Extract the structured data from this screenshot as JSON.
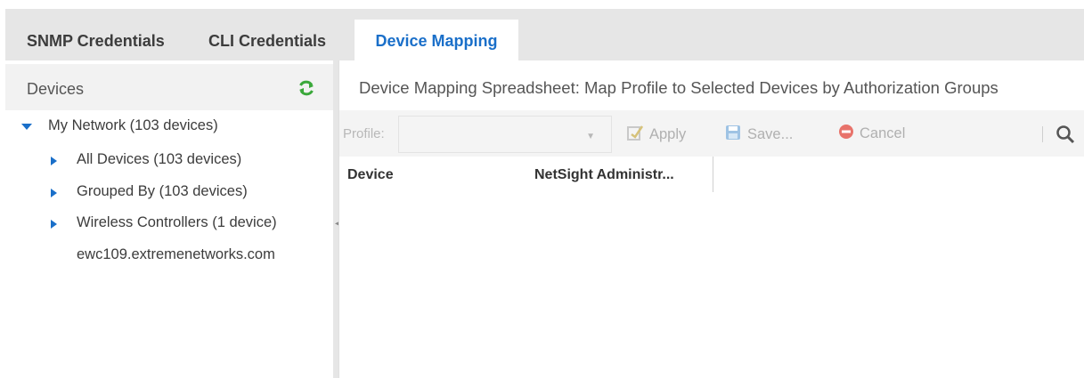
{
  "tabs": [
    {
      "label": "SNMP Credentials"
    },
    {
      "label": "CLI Credentials"
    },
    {
      "label": "Device Mapping"
    }
  ],
  "devices_panel": {
    "title": "Devices",
    "refresh_icon": "refresh-icon",
    "tree": [
      {
        "label": "My Network (103 devices)",
        "icon": "caret-down-icon"
      },
      {
        "label": "All Devices (103 devices)",
        "icon": "caret-right-icon"
      },
      {
        "label": "Grouped By (103 devices)",
        "icon": "caret-right-icon"
      },
      {
        "label": "Wireless Controllers (1 device)",
        "icon": "caret-right-icon"
      },
      {
        "label": "ewc109.extremenetworks.com"
      }
    ]
  },
  "mapping": {
    "title": "Device Mapping Spreadsheet: Map Profile to Selected Devices by Authorization Groups",
    "toolbar": {
      "profile_label": "Profile:",
      "profile_value": "",
      "apply_label": "Apply",
      "save_label": "Save...",
      "cancel_label": "Cancel"
    },
    "columns": [
      "Device",
      "NetSight Administr..."
    ]
  },
  "colors": {
    "accent": "#1a6fc9",
    "refresh": "#3aa83a",
    "tree_caret": "#1a6fc9",
    "cancel": "#e8736b"
  }
}
